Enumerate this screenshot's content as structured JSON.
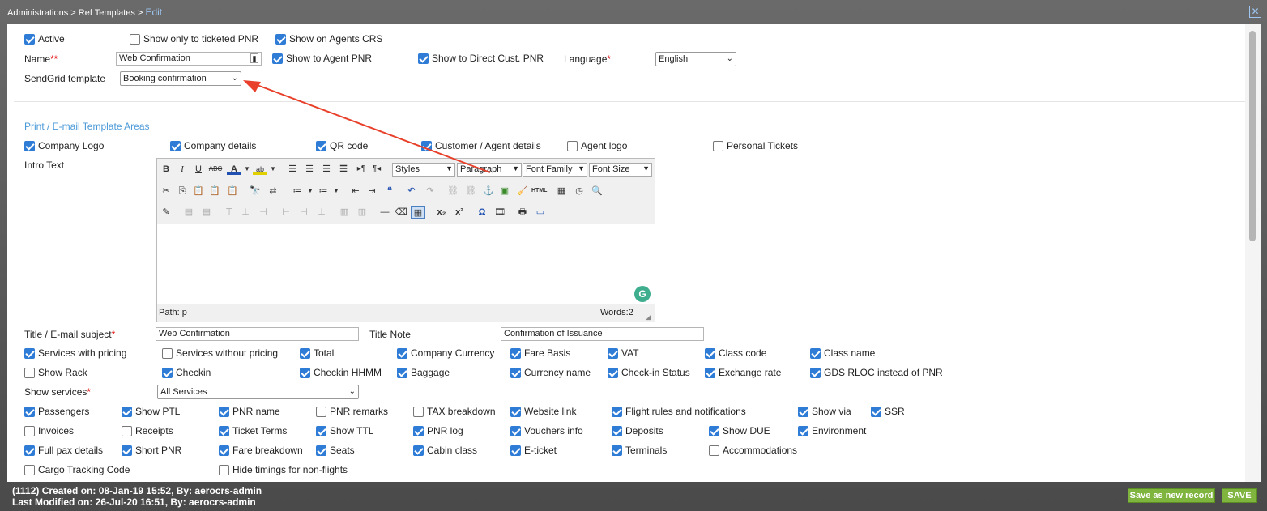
{
  "breadcrumb": {
    "admin": "Administrations",
    "sep1": ">",
    "ref": "Ref Templates",
    "sep2": ">",
    "current": "Edit"
  },
  "close_icon": "close-icon",
  "top": {
    "active": {
      "label": "Active",
      "checked": true
    },
    "show_ticketed": {
      "label": "Show only to ticketed PNR",
      "checked": false
    },
    "show_agents_crs": {
      "label": "Show on Agents CRS",
      "checked": true
    },
    "name_label": "Name",
    "name_req": "**",
    "name_value": "Web Confirmation",
    "show_agent_pnr": {
      "label": "Show to Agent PNR",
      "checked": true
    },
    "show_direct": {
      "label": "Show to Direct Cust. PNR",
      "checked": true
    },
    "language_label": "Language",
    "language_req": "*",
    "language_value": "English",
    "sendgrid_label": "SendGrid template",
    "sendgrid_value": "Booking confirmation"
  },
  "areas_title": "Print / E-mail Template Areas",
  "areas": [
    {
      "label": "Company Logo",
      "checked": true
    },
    {
      "label": "Company details",
      "checked": true
    },
    {
      "label": "QR code",
      "checked": true
    },
    {
      "label": "Customer / Agent details",
      "checked": true
    },
    {
      "label": "Agent logo",
      "checked": false
    },
    {
      "label": "Personal Tickets",
      "checked": false
    }
  ],
  "intro_label": "Intro Text",
  "editor": {
    "styles": "Styles",
    "paragraph": "Paragraph",
    "font_family": "Font Family",
    "font_size": "Font Size",
    "path": "Path: p",
    "words": "Words:2",
    "grammarly": "G"
  },
  "title_label": "Title / E-mail subject",
  "title_req": "*",
  "title_value": "Web Confirmation",
  "title_note_label": "Title Note",
  "title_note_value": "Confirmation of Issuance",
  "row1": [
    {
      "label": "Services with pricing",
      "checked": true
    },
    {
      "label": "Services without pricing",
      "checked": false
    },
    {
      "label": "Total",
      "checked": true
    },
    {
      "label": "Company Currency",
      "checked": true
    },
    {
      "label": "Fare Basis",
      "checked": true
    },
    {
      "label": "VAT",
      "checked": true
    },
    {
      "label": "Class code",
      "checked": true
    },
    {
      "label": "Class name",
      "checked": true
    }
  ],
  "row2": [
    {
      "label": "Show Rack",
      "checked": false
    },
    {
      "label": "Checkin",
      "checked": true
    },
    {
      "label": "Checkin HHMM",
      "checked": true
    },
    {
      "label": "Baggage",
      "checked": true
    },
    {
      "label": "Currency name",
      "checked": true
    },
    {
      "label": "Check-in Status",
      "checked": true
    },
    {
      "label": "Exchange rate",
      "checked": true
    },
    {
      "label": "GDS RLOC instead of PNR",
      "checked": true
    }
  ],
  "show_services_label": "Show services",
  "show_services_req": "*",
  "show_services_value": "All Services",
  "row3": [
    {
      "label": "Passengers",
      "checked": true
    },
    {
      "label": "Show PTL",
      "checked": true
    },
    {
      "label": "PNR name",
      "checked": true
    },
    {
      "label": "PNR remarks",
      "checked": false
    },
    {
      "label": "TAX breakdown",
      "checked": false
    },
    {
      "label": "Website link",
      "checked": true
    },
    {
      "label": "Flight rules and notifications",
      "checked": true
    },
    {
      "label": "Show via",
      "checked": true
    },
    {
      "label": "SSR",
      "checked": true
    }
  ],
  "row4": [
    {
      "label": "Invoices",
      "checked": false
    },
    {
      "label": "Receipts",
      "checked": false
    },
    {
      "label": "Ticket Terms",
      "checked": true
    },
    {
      "label": "Show TTL",
      "checked": true
    },
    {
      "label": "PNR log",
      "checked": true
    },
    {
      "label": "Vouchers info",
      "checked": true
    },
    {
      "label": "Deposits",
      "checked": true
    },
    {
      "label": "Show DUE",
      "checked": true
    },
    {
      "label": "Environment",
      "checked": true
    }
  ],
  "row5": [
    {
      "label": "Full pax details",
      "checked": true
    },
    {
      "label": "Short PNR",
      "checked": true
    },
    {
      "label": "Fare breakdown",
      "checked": true
    },
    {
      "label": "Seats",
      "checked": true
    },
    {
      "label": "Cabin class",
      "checked": true
    },
    {
      "label": "E-ticket",
      "checked": true
    },
    {
      "label": "Terminals",
      "checked": true
    },
    {
      "label": "Accommodations",
      "checked": false
    }
  ],
  "row6": [
    {
      "label": "Cargo Tracking Code",
      "checked": false
    },
    {
      "label": "Hide timings for non-flights",
      "checked": false
    }
  ],
  "footer": {
    "created": "(1112) Created on: 08-Jan-19 15:52, By: aerocrs-admin",
    "modified": "Last Modified on: 26-Jul-20 16:51, By: aerocrs-admin",
    "save_new": "Save as new record",
    "save": "SAVE"
  },
  "annotation_color": "#e8402a"
}
